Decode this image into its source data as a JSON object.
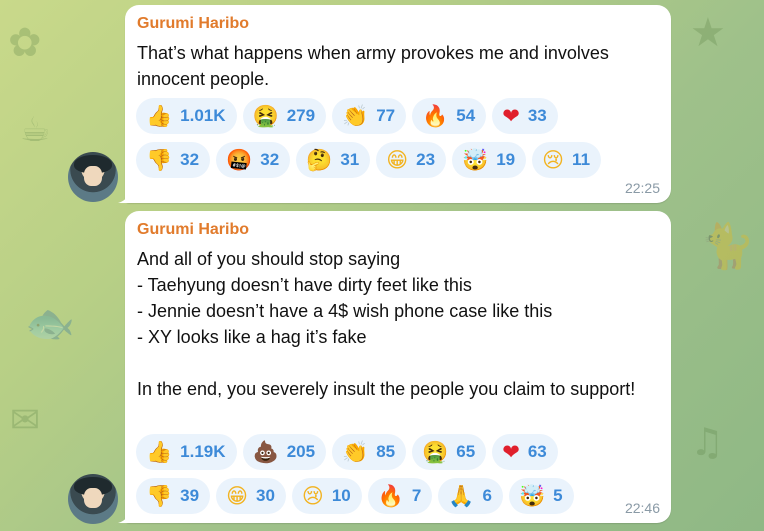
{
  "messages": [
    {
      "sender": "Gurumi Haribo",
      "text": "That’s what happens when army provokes me and involves innocent people.",
      "time": "22:25",
      "reaction_rows": [
        [
          {
            "emoji": "👍",
            "count": "1.01K",
            "icon": "thumbs-up-icon",
            "color": "#f2b320"
          },
          {
            "emoji": "🤮",
            "count": "279",
            "icon": "vomit-face-icon",
            "color": "#5cb34a"
          },
          {
            "emoji": "👏",
            "count": "77",
            "icon": "clap-icon",
            "color": "#f2b320"
          },
          {
            "emoji": "🔥",
            "count": "54",
            "icon": "fire-icon",
            "color": "#f05a1a"
          },
          {
            "emoji": "❤",
            "count": "33",
            "icon": "heart-icon",
            "color": "#e01f2c"
          }
        ],
        [
          {
            "emoji": "👎",
            "count": "32",
            "icon": "thumbs-down-icon",
            "color": "#f2b320"
          },
          {
            "emoji": "🤬",
            "count": "32",
            "icon": "cursing-face-icon",
            "color": "#d93025"
          },
          {
            "emoji": "🤔",
            "count": "31",
            "icon": "thinking-face-icon",
            "color": "#f2b320"
          },
          {
            "emoji": "😁",
            "count": "23",
            "icon": "grinning-face-icon",
            "color": "#f2b320"
          },
          {
            "emoji": "🤯",
            "count": "19",
            "icon": "exploding-head-icon",
            "color": "#f2b320"
          },
          {
            "emoji": "😢",
            "count": "11",
            "icon": "crying-face-icon",
            "color": "#f2b320"
          }
        ]
      ]
    },
    {
      "sender": "Gurumi Haribo",
      "text": "And all of you should stop saying\n- Taehyung doesn’t have dirty feet like this\n- Jennie doesn’t have a 4$ wish phone case like this\n- XY looks like a hag it’s fake\n\nIn the end, you severely insult the people you claim to support!",
      "time": "22:46",
      "reaction_rows": [
        [
          {
            "emoji": "👍",
            "count": "1.19K",
            "icon": "thumbs-up-icon",
            "color": "#f2b320"
          },
          {
            "emoji": "💩",
            "count": "205",
            "icon": "poop-icon",
            "color": "#8b5a2b"
          },
          {
            "emoji": "👏",
            "count": "85",
            "icon": "clap-icon",
            "color": "#f2b320"
          },
          {
            "emoji": "🤮",
            "count": "65",
            "icon": "vomit-face-icon",
            "color": "#5cb34a"
          },
          {
            "emoji": "❤",
            "count": "63",
            "icon": "heart-icon",
            "color": "#e01f2c"
          }
        ],
        [
          {
            "emoji": "👎",
            "count": "39",
            "icon": "thumbs-down-icon",
            "color": "#f2b320"
          },
          {
            "emoji": "😁",
            "count": "30",
            "icon": "grinning-face-icon",
            "color": "#f2b320"
          },
          {
            "emoji": "😢",
            "count": "10",
            "icon": "crying-face-icon",
            "color": "#f2b320"
          },
          {
            "emoji": "🔥",
            "count": "7",
            "icon": "fire-icon",
            "color": "#f05a1a"
          },
          {
            "emoji": "🙏",
            "count": "6",
            "icon": "folded-hands-icon",
            "color": "#f2b320"
          },
          {
            "emoji": "🤯",
            "count": "5",
            "icon": "exploding-head-icon",
            "color": "#f2b320"
          }
        ]
      ]
    }
  ]
}
